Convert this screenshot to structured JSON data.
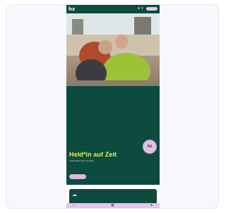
{
  "app": {
    "logo_text": "hz"
  },
  "topbar": {
    "pill_label": "",
    "icons": [
      "bell-icon",
      "menu-icon"
    ]
  },
  "hero": {
    "headline": "Held*in auf Zeit",
    "subline": "Unterstützung für Familien",
    "paragraph": "",
    "button_label": "",
    "badge_text": "hz"
  },
  "colors": {
    "brand_green": "#0d4a3f",
    "accent_lime": "#e6f05a",
    "accent_lilac": "#d9b8df"
  },
  "bottom_nav": {
    "items": [
      {
        "icon": "home-icon"
      },
      {
        "icon": "grid-icon"
      },
      {
        "icon": "user-icon"
      }
    ]
  }
}
